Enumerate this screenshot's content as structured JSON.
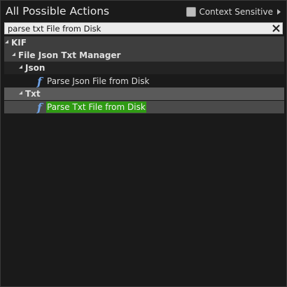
{
  "header": {
    "title": "All Possible Actions",
    "context_sensitive_label": "Context Sensitive",
    "context_sensitive_checked": false
  },
  "search": {
    "value": "parse txt File from Disk",
    "clear_icon": "close-icon"
  },
  "tree": {
    "root_label": "KIF",
    "category_label": "File Json Txt Manager",
    "json_label": "Json",
    "json_action_label": "Parse Json File from Disk",
    "txt_label": "Txt",
    "txt_action_label": "Parse Txt File from Disk",
    "function_icon": "function-icon"
  },
  "colors": {
    "highlight": "#2f9a13",
    "function_icon": "#6fa2e6"
  }
}
